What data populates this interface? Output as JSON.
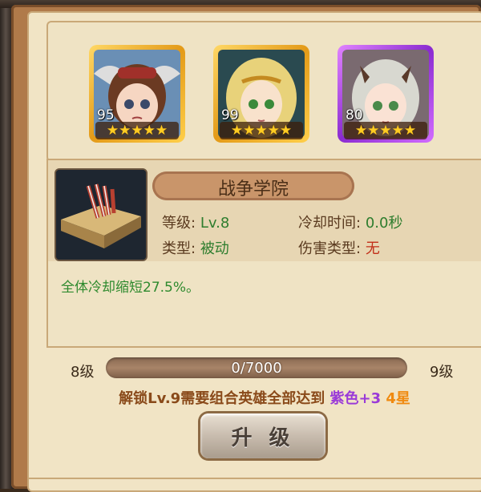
{
  "heroes": [
    {
      "level": "95",
      "stars": "★★★★★",
      "frame": "gold"
    },
    {
      "level": "99",
      "stars": "★★★★★",
      "frame": "gold"
    },
    {
      "level": "80",
      "stars": "★★★★★",
      "frame": "purple"
    }
  ],
  "skill": {
    "name": "战争学院",
    "level_label": "等级:",
    "level_value": "Lv.8",
    "cooldown_label": "冷却时间:",
    "cooldown_value": "0.0秒",
    "type_label": "类型:",
    "type_value": "被动",
    "damage_type_label": "伤害类型:",
    "damage_type_value": "无",
    "description": "全体冷却缩短27.5%。"
  },
  "progress": {
    "current_level": "8级",
    "next_level": "9级",
    "text": "0/7000",
    "fraction": 0
  },
  "unlock": {
    "prefix": "解锁Lv.9需要组合英雄全部达到 ",
    "quality": "紫色+3",
    "stars": " 4星"
  },
  "upgrade_button": "升 级"
}
